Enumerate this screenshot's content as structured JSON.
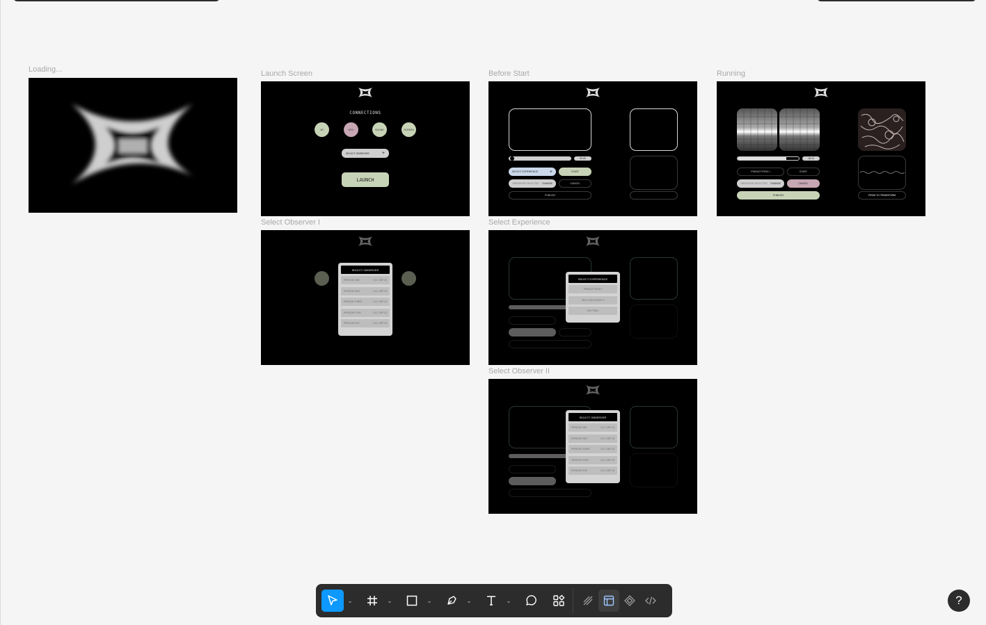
{
  "frames": {
    "loading": {
      "label": "Loading..."
    },
    "launch": {
      "label": "Launch Screen",
      "connections_title": "CONNECTIONS",
      "connections": [
        "VR",
        "EEG",
        "SOUND",
        "SCREEN"
      ],
      "select_observer": "SELECT OBSERVER",
      "launch_button": "LAUNCH"
    },
    "before_start": {
      "label": "Before Start",
      "timer": "00:00",
      "select_experience": "SELECT EXPERIENCE",
      "start": "START",
      "observer_field": "OBSERVER SELECTED",
      "change": "CHANGE",
      "cancel": "CANCEL",
      "publish": "PUBLISH"
    },
    "running": {
      "label": "Running",
      "timer": "18:13",
      "experience": "PHENOTYPING I",
      "start": "START",
      "observer_field": "OBSERVER SELECTED",
      "change": "CHANGE",
      "cancel": "CANCEL",
      "publish": "PUBLISH",
      "transform": "FROM TO TRANSFORM"
    },
    "observer_1": {
      "label": "Select Observer I",
      "header": "SELECT OBSERVER",
      "rows": [
        {
          "name": "PERSON ONE",
          "date": "3.12. SEP 23"
        },
        {
          "name": "PERSON TWO",
          "date": "3.12. SEP 23"
        },
        {
          "name": "PERSON THREE",
          "date": "3.12. SEP 23"
        },
        {
          "name": "PERSON FOUR",
          "date": "3.12. SEP 23"
        },
        {
          "name": "PERSON FIVE",
          "date": "3.12. SEP 23"
        }
      ]
    },
    "experience": {
      "label": "Select Experience",
      "header": "SELECT EXPERIENCE",
      "rows": [
        "PHENOTYPING I",
        "SELF DISCOVERY II",
        "ION TRIAL"
      ]
    },
    "observer_2": {
      "label": "Select Observer II",
      "header": "SELECT OBSERVER",
      "rows": [
        {
          "name": "PERSON ONE",
          "date": "3.12. SEP 23"
        },
        {
          "name": "PERSON TWO",
          "date": "3.12. SEP 23"
        },
        {
          "name": "PERSON THREE",
          "date": "3.12. SEP 23"
        },
        {
          "name": "PERSON FOUR",
          "date": "3.12. SEP 23"
        },
        {
          "name": "PERSON FIVE",
          "date": "3.12. SEP 23"
        }
      ]
    }
  },
  "toolbar": {
    "tools": [
      "move-tool",
      "frame-tool",
      "rectangle-tool",
      "pen-tool",
      "text-tool",
      "comment-tool",
      "assets-tool"
    ],
    "modes": [
      "draw-mode",
      "design-mode",
      "dev-mode-components",
      "code-mode"
    ],
    "accent": "#0d99ff"
  },
  "help": {
    "label": "?"
  }
}
